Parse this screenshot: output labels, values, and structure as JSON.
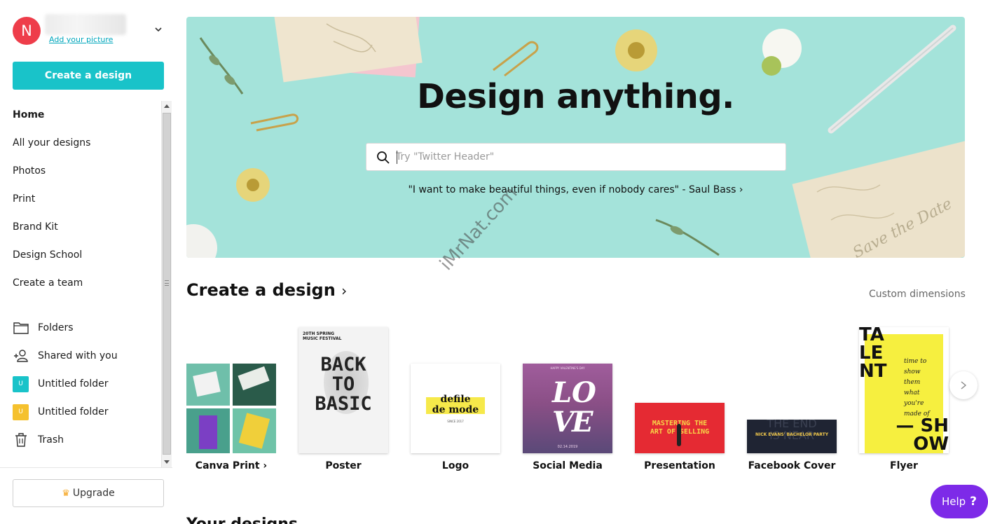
{
  "sidebar": {
    "avatar_initial": "N",
    "add_picture": "Add your picture",
    "create_button": "Create a design",
    "nav": [
      {
        "label": "Home",
        "active": true
      },
      {
        "label": "All your designs"
      },
      {
        "label": "Photos"
      },
      {
        "label": "Print"
      },
      {
        "label": "Brand Kit"
      },
      {
        "label": "Design School"
      },
      {
        "label": "Create a team"
      }
    ],
    "folders": [
      {
        "label": "Folders",
        "icon": "folder-icon"
      },
      {
        "label": "Shared with you",
        "icon": "shared-users-icon"
      },
      {
        "label": "Untitled folder",
        "badge": "U",
        "color": "#19c3c9"
      },
      {
        "label": "Untitled folder",
        "badge": "U",
        "color": "#f5c12e"
      },
      {
        "label": "Trash",
        "icon": "trash-icon"
      }
    ],
    "upgrade_button": "Upgrade"
  },
  "hero": {
    "title": "Design anything.",
    "search_placeholder": "Try \"Twitter Header\"",
    "quote": "\"I want to make beautiful things, even if nobody cares\" - Saul Bass ›",
    "background": "#a4e3da"
  },
  "create_section": {
    "title": "Create a design",
    "chevron": "›",
    "custom_dimensions": "Custom dimensions",
    "templates": [
      {
        "label": "Canva Print ›"
      },
      {
        "label": "Poster",
        "thumb_text": [
          "BACK",
          "TO",
          "BASIC"
        ],
        "thumb_header": [
          "20TH SPRING",
          "MUSIC FESTIVAL"
        ]
      },
      {
        "label": "Logo",
        "thumb_text": [
          "defile",
          "de mode"
        ],
        "thumb_sub": "SINCE 2017"
      },
      {
        "label": "Social Media",
        "thumb_text": [
          "L",
          "O",
          "V",
          "E"
        ],
        "thumb_header": "HAPPY VALENTINE'S DAY",
        "thumb_sub": "02.14.2019"
      },
      {
        "label": "Presentation",
        "thumb_text": [
          "MASTERING THE",
          "ART OF SELLING"
        ]
      },
      {
        "label": "Facebook Cover",
        "thumb_text": [
          "NICK EVANS' BACHELOR PARTY"
        ],
        "thumb_bg_text": [
          "THE END",
          "IS NEAR"
        ]
      },
      {
        "label": "Flyer",
        "thumb_text": [
          "TA",
          "LE",
          "NT",
          "— SH",
          "OW"
        ],
        "thumb_script": [
          "time to",
          "show",
          "them",
          "what",
          "you're",
          "made of"
        ]
      }
    ]
  },
  "watermark": "iMrNat.com",
  "next_section_title": "Your designs",
  "help": {
    "label": "Help",
    "glyph": "?",
    "color": "#7d2ae8"
  }
}
